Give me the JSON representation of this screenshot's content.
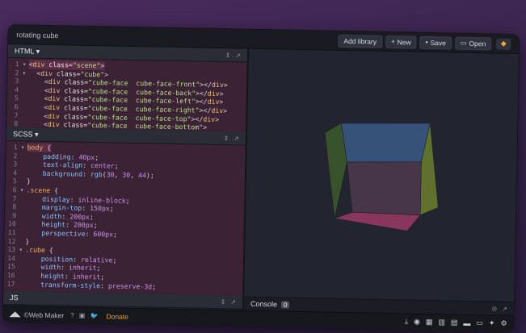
{
  "header": {
    "title": "rotating cube",
    "buttons": {
      "add_library": "Add library",
      "new": "New",
      "save": "Save",
      "open": "Open"
    },
    "icons": {
      "new": "+",
      "save": "💾",
      "open": "▭",
      "logo": "◆"
    }
  },
  "panes": {
    "html": {
      "label": "HTML"
    },
    "css": {
      "label": "SCSS"
    },
    "js": {
      "label": "JS"
    },
    "controls": {
      "collapse": "⇕",
      "expand": "↗"
    }
  },
  "html_code": [
    {
      "n": "1",
      "fold": "▾",
      "hl": true,
      "parts": [
        [
          "punc",
          "<"
        ],
        [
          "tag",
          "div"
        ],
        [
          "attr",
          " class="
        ],
        [
          "str",
          "\"scene\""
        ],
        [
          "punc",
          ">"
        ]
      ]
    },
    {
      "n": "2",
      "fold": "▾",
      "hl": false,
      "parts": [
        [
          "punc",
          "  <"
        ],
        [
          "tag",
          "div"
        ],
        [
          "attr",
          " class="
        ],
        [
          "str",
          "\"cube\""
        ],
        [
          "punc",
          ">"
        ]
      ]
    },
    {
      "n": "3",
      "fold": "",
      "hl": false,
      "parts": [
        [
          "punc",
          "    <"
        ],
        [
          "tag",
          "div"
        ],
        [
          "attr",
          " class="
        ],
        [
          "str",
          "\"cube-face  cube-face-front\""
        ],
        [
          "punc",
          "></"
        ],
        [
          "tag",
          "div"
        ],
        [
          "punc",
          ">"
        ]
      ]
    },
    {
      "n": "4",
      "fold": "",
      "hl": false,
      "parts": [
        [
          "punc",
          "    <"
        ],
        [
          "tag",
          "div"
        ],
        [
          "attr",
          " class="
        ],
        [
          "str",
          "\"cube-face  cube-face-back\""
        ],
        [
          "punc",
          "></"
        ],
        [
          "tag",
          "div"
        ],
        [
          "punc",
          ">"
        ]
      ]
    },
    {
      "n": "5",
      "fold": "",
      "hl": false,
      "parts": [
        [
          "punc",
          "    <"
        ],
        [
          "tag",
          "div"
        ],
        [
          "attr",
          " class="
        ],
        [
          "str",
          "\"cube-face  cube-face-left\""
        ],
        [
          "punc",
          "></"
        ],
        [
          "tag",
          "div"
        ],
        [
          "punc",
          ">"
        ]
      ]
    },
    {
      "n": "6",
      "fold": "",
      "hl": false,
      "parts": [
        [
          "punc",
          "    <"
        ],
        [
          "tag",
          "div"
        ],
        [
          "attr",
          " class="
        ],
        [
          "str",
          "\"cube-face  cube-face-right\""
        ],
        [
          "punc",
          "></"
        ],
        [
          "tag",
          "div"
        ],
        [
          "punc",
          ">"
        ]
      ]
    },
    {
      "n": "7",
      "fold": "",
      "hl": false,
      "parts": [
        [
          "punc",
          "    <"
        ],
        [
          "tag",
          "div"
        ],
        [
          "attr",
          " class="
        ],
        [
          "str",
          "\"cube-face  cube-face-top\""
        ],
        [
          "punc",
          "></"
        ],
        [
          "tag",
          "div"
        ],
        [
          "punc",
          ">"
        ]
      ]
    },
    {
      "n": "8",
      "fold": "",
      "hl": false,
      "parts": [
        [
          "punc",
          "    <"
        ],
        [
          "tag",
          "div"
        ],
        [
          "attr",
          " class="
        ],
        [
          "str",
          "\"cube-face  cube-face-bottom\""
        ],
        [
          "punc",
          ">"
        ]
      ]
    },
    {
      "n": "",
      "fold": "",
      "hl": false,
      "parts": [
        [
          "punc",
          "  </"
        ],
        [
          "tag",
          "div"
        ],
        [
          "punc",
          ">"
        ]
      ]
    }
  ],
  "css_code": [
    {
      "n": "1",
      "fold": "▾",
      "hl": true,
      "parts": [
        [
          "sel",
          "body"
        ],
        [
          "punc",
          " {"
        ]
      ]
    },
    {
      "n": "2",
      "fold": "",
      "hl": false,
      "parts": [
        [
          "prop",
          "    padding"
        ],
        [
          "punc",
          ": "
        ],
        [
          "val",
          "40px"
        ],
        [
          "punc",
          ";"
        ]
      ]
    },
    {
      "n": "3",
      "fold": "",
      "hl": false,
      "parts": [
        [
          "prop",
          "    text-align"
        ],
        [
          "punc",
          ": "
        ],
        [
          "val",
          "center"
        ],
        [
          "punc",
          ";"
        ]
      ]
    },
    {
      "n": "4",
      "fold": "",
      "hl": false,
      "parts": [
        [
          "prop",
          "    background"
        ],
        [
          "punc",
          ": "
        ],
        [
          "prop",
          "rgb"
        ],
        [
          "punc",
          "("
        ],
        [
          "val",
          "30"
        ],
        [
          "punc",
          ", "
        ],
        [
          "val",
          "30"
        ],
        [
          "punc",
          ", "
        ],
        [
          "val",
          "44"
        ],
        [
          "punc",
          ");"
        ]
      ]
    },
    {
      "n": "5",
      "fold": "",
      "hl": false,
      "parts": [
        [
          "punc",
          "}"
        ]
      ]
    },
    {
      "n": "6",
      "fold": "▾",
      "hl": false,
      "parts": [
        [
          "sel",
          ".scene"
        ],
        [
          "punc",
          " {"
        ]
      ]
    },
    {
      "n": "7",
      "fold": "",
      "hl": false,
      "parts": [
        [
          "prop",
          "    display"
        ],
        [
          "punc",
          ": "
        ],
        [
          "val",
          "inline-block"
        ],
        [
          "punc",
          ";"
        ]
      ]
    },
    {
      "n": "8",
      "fold": "",
      "hl": false,
      "parts": [
        [
          "prop",
          "    margin-top"
        ],
        [
          "punc",
          ": "
        ],
        [
          "val",
          "150px"
        ],
        [
          "punc",
          ";"
        ]
      ]
    },
    {
      "n": "9",
      "fold": "",
      "hl": false,
      "parts": [
        [
          "prop",
          "    width"
        ],
        [
          "punc",
          ": "
        ],
        [
          "val",
          "200px"
        ],
        [
          "punc",
          ";"
        ]
      ]
    },
    {
      "n": "10",
      "fold": "",
      "hl": false,
      "parts": [
        [
          "prop",
          "    height"
        ],
        [
          "punc",
          ": "
        ],
        [
          "val",
          "200px"
        ],
        [
          "punc",
          ";"
        ]
      ]
    },
    {
      "n": "11",
      "fold": "",
      "hl": false,
      "parts": [
        [
          "prop",
          "    perspective"
        ],
        [
          "punc",
          ": "
        ],
        [
          "val",
          "600px"
        ],
        [
          "punc",
          ";"
        ]
      ]
    },
    {
      "n": "12",
      "fold": "",
      "hl": false,
      "parts": [
        [
          "punc",
          "}"
        ]
      ]
    },
    {
      "n": "13",
      "fold": "▾",
      "hl": false,
      "parts": [
        [
          "sel",
          ".cube"
        ],
        [
          "punc",
          " {"
        ]
      ]
    },
    {
      "n": "14",
      "fold": "",
      "hl": false,
      "parts": [
        [
          "prop",
          "    position"
        ],
        [
          "punc",
          ": "
        ],
        [
          "val",
          "relative"
        ],
        [
          "punc",
          ";"
        ]
      ]
    },
    {
      "n": "15",
      "fold": "",
      "hl": false,
      "parts": [
        [
          "prop",
          "    width"
        ],
        [
          "punc",
          ": "
        ],
        [
          "val",
          "inherit"
        ],
        [
          "punc",
          ";"
        ]
      ]
    },
    {
      "n": "16",
      "fold": "",
      "hl": false,
      "parts": [
        [
          "prop",
          "    height"
        ],
        [
          "punc",
          ": "
        ],
        [
          "val",
          "inherit"
        ],
        [
          "punc",
          ";"
        ]
      ]
    },
    {
      "n": "17",
      "fold": "",
      "hl": false,
      "parts": [
        [
          "prop",
          "    transform-style"
        ],
        [
          "punc",
          ": "
        ],
        [
          "val",
          "preserve-3d"
        ],
        [
          "punc",
          ";"
        ]
      ]
    }
  ],
  "console": {
    "label": "Console",
    "count": "0"
  },
  "footer": {
    "brand": "©Web Maker",
    "social_icons": "? ▣ 🐦",
    "donate": "Donate",
    "icons": [
      "⤓",
      "◉",
      "▦",
      "▥",
      "▤",
      "▬",
      "▭",
      "✦",
      "⚙"
    ]
  },
  "colors": {
    "cube_top": "#3a5a86",
    "cube_right": "#6a7f2d",
    "cube_bottom": "#9a3a63",
    "cube_left": "#3c5a2c",
    "cube_front": "#4d3a4f"
  }
}
